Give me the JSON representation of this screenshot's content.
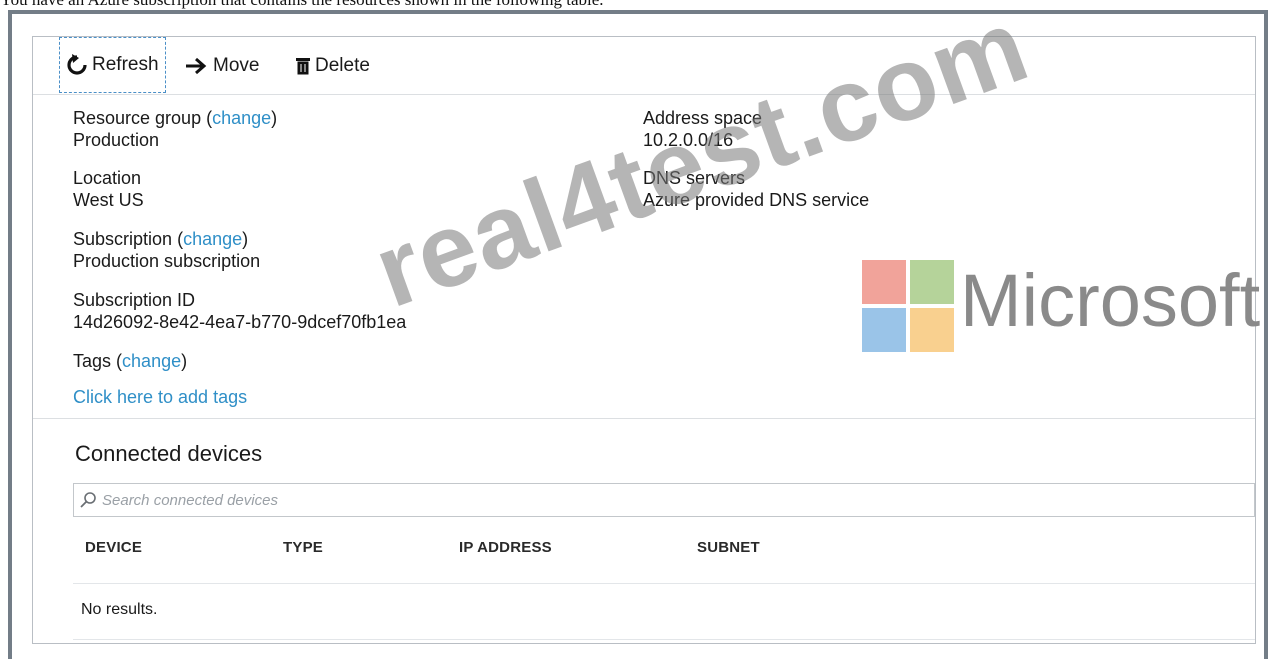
{
  "caption": "You have an Azure subscription that contains the resources shown in the following table.",
  "toolbar": {
    "refresh_label": "Refresh",
    "move_label": "Move",
    "delete_label": "Delete"
  },
  "properties": {
    "resource_group_label": "Resource group",
    "resource_group_change": "change",
    "resource_group_value": "Production",
    "location_label": "Location",
    "location_value": "West US",
    "subscription_label": "Subscription",
    "subscription_change": "change",
    "subscription_value": "Production subscription",
    "subscription_id_label": "Subscription ID",
    "subscription_id_value": "14d26092-8e42-4ea7-b770-9dcef70fb1ea",
    "tags_label": "Tags",
    "tags_change": "change",
    "tags_value": "Click here to add tags",
    "address_space_label": "Address space",
    "address_space_value": "10.2.0.0/16",
    "dns_label": "DNS servers",
    "dns_value": "Azure provided DNS service"
  },
  "connected_devices": {
    "title": "Connected devices",
    "search_placeholder": "Search connected devices",
    "columns": [
      "DEVICE",
      "TYPE",
      "IP ADDRESS",
      "SUBNET"
    ],
    "empty_text": "No results."
  },
  "watermark": {
    "text": "real4test.com",
    "brand_text": "Microsoft",
    "logo_colors": [
      "#f1a39a",
      "#b5d39a",
      "#9ac4e8",
      "#f9d08f"
    ]
  },
  "colors": {
    "link": "#2f8fc7",
    "frame": "#737d87"
  }
}
